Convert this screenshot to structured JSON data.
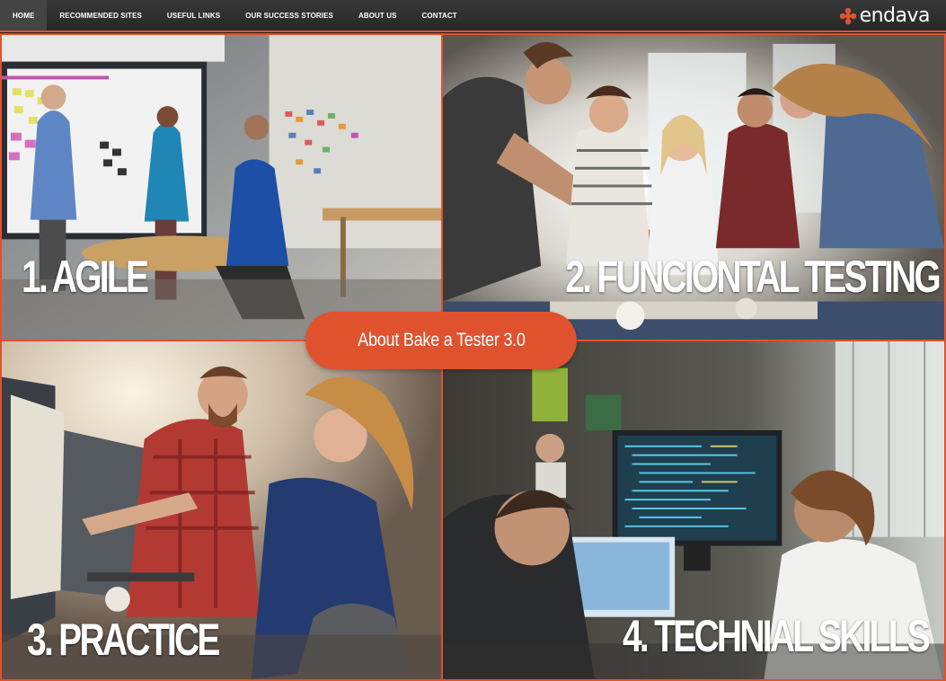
{
  "navbar": {
    "items": [
      {
        "label": "HOME",
        "active": true
      },
      {
        "label": "RECOMMENDED SITES",
        "active": false
      },
      {
        "label": "USEFUL LINKS",
        "active": false
      },
      {
        "label": "OUR SUCCESS STORIES",
        "active": false
      },
      {
        "label": "ABOUT US",
        "active": false
      },
      {
        "label": "CONTACT",
        "active": false
      }
    ],
    "logo": {
      "text": "endava",
      "icon": "endava-dots-icon"
    }
  },
  "panels": [
    {
      "title": "1. AGILE",
      "image": "team-whiteboard-photo"
    },
    {
      "title": "2. FUNCIONTAL TESTING",
      "image": "team-collaboration-photo"
    },
    {
      "title": "3. PRACTICE",
      "image": "pair-at-monitor-photo"
    },
    {
      "title": "4. TECHNIAL SKILLS",
      "image": "developers-coding-photo"
    }
  ],
  "about_button": {
    "label": "About Bake a Tester 3.0"
  },
  "colors": {
    "accent": "#e0522e",
    "navbar": "#2f2f2f",
    "text": "#ffffff"
  }
}
